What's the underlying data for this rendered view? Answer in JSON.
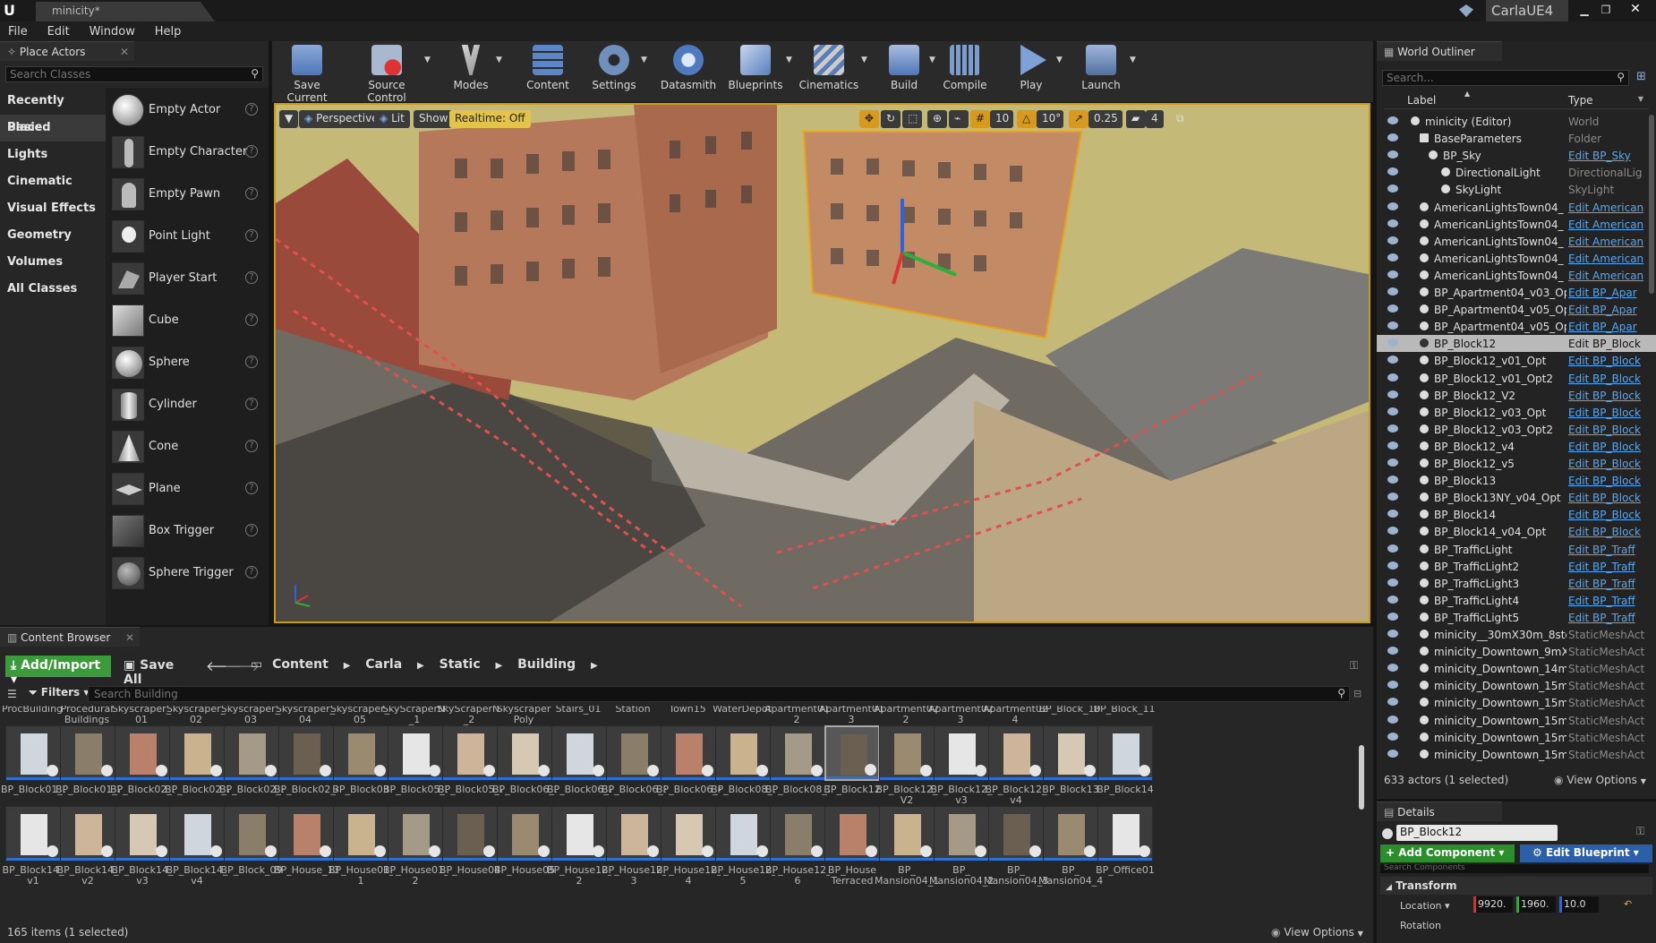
{
  "titlebar": {
    "tab_title": "minicity*",
    "project_name": "CarlaUE4"
  },
  "menu": [
    "File",
    "Edit",
    "Window",
    "Help"
  ],
  "place_actors": {
    "tab_label": "Place Actors",
    "search_placeholder": "Search Classes",
    "categories": [
      "Recently Placed",
      "Basic",
      "Lights",
      "Cinematic",
      "Visual Effects",
      "Geometry",
      "Volumes",
      "All Classes"
    ],
    "selected_category": "Basic",
    "items": [
      "Empty Actor",
      "Empty Character",
      "Empty Pawn",
      "Point Light",
      "Player Start",
      "Cube",
      "Sphere",
      "Cylinder",
      "Cone",
      "Plane",
      "Box Trigger",
      "Sphere Trigger"
    ]
  },
  "toolbar": {
    "buttons": [
      "Save Current",
      "Source Control",
      "Modes",
      "Content",
      "Settings",
      "Datasmith",
      "Blueprints",
      "Cinematics",
      "Build",
      "Compile",
      "Play",
      "Launch"
    ]
  },
  "viewport": {
    "perspective": "Perspective",
    "lit": "Lit",
    "show": "Show",
    "realtime": "Realtime: Off",
    "grid_snap": "10",
    "rotation_snap": "10°",
    "scale_snap": "0.25",
    "camera_speed": "4"
  },
  "outliner": {
    "tab_label": "World Outliner",
    "search_placeholder": "Search...",
    "col_label": "Label",
    "col_type": "Type",
    "rows": [
      {
        "label": "minicity (Editor)",
        "type": "World",
        "indent": 1,
        "link": false
      },
      {
        "label": "BaseParameters",
        "type": "Folder",
        "indent": 2,
        "link": false
      },
      {
        "label": "BP_Sky",
        "type": "Edit BP_Sky",
        "indent": 3,
        "link": true
      },
      {
        "label": "DirectionalLight",
        "type": "DirectionalLig",
        "indent": 4,
        "link": false
      },
      {
        "label": "SkyLight",
        "type": "SkyLight",
        "indent": 4,
        "link": false
      },
      {
        "label": "AmericanLightsTown04_",
        "type": "Edit American",
        "indent": 2,
        "link": true
      },
      {
        "label": "AmericanLightsTown04_",
        "type": "Edit American",
        "indent": 2,
        "link": true
      },
      {
        "label": "AmericanLightsTown04_",
        "type": "Edit American",
        "indent": 2,
        "link": true
      },
      {
        "label": "AmericanLightsTown04_",
        "type": "Edit American",
        "indent": 2,
        "link": true
      },
      {
        "label": "AmericanLightsTown04_",
        "type": "Edit American",
        "indent": 2,
        "link": true
      },
      {
        "label": "BP_Apartment04_v03_Op",
        "type": "Edit BP_Apar",
        "indent": 2,
        "link": true
      },
      {
        "label": "BP_Apartment04_v05_Op",
        "type": "Edit BP_Apar",
        "indent": 2,
        "link": true
      },
      {
        "label": "BP_Apartment04_v05_Op",
        "type": "Edit BP_Apar",
        "indent": 2,
        "link": true
      },
      {
        "label": "BP_Block12",
        "type": "Edit BP_Block",
        "indent": 2,
        "link": false,
        "selected": true
      },
      {
        "label": "BP_Block12_v01_Opt",
        "type": "Edit BP_Block",
        "indent": 2,
        "link": true
      },
      {
        "label": "BP_Block12_v01_Opt2",
        "type": "Edit BP_Block",
        "indent": 2,
        "link": true
      },
      {
        "label": "BP_Block12_V2",
        "type": "Edit BP_Block",
        "indent": 2,
        "link": true
      },
      {
        "label": "BP_Block12_v03_Opt",
        "type": "Edit BP_Block",
        "indent": 2,
        "link": true
      },
      {
        "label": "BP_Block12_v03_Opt2",
        "type": "Edit BP_Block",
        "indent": 2,
        "link": true
      },
      {
        "label": "BP_Block12_v4",
        "type": "Edit BP_Block",
        "indent": 2,
        "link": true
      },
      {
        "label": "BP_Block12_v5",
        "type": "Edit BP_Block",
        "indent": 2,
        "link": true
      },
      {
        "label": "BP_Block13",
        "type": "Edit BP_Block",
        "indent": 2,
        "link": true
      },
      {
        "label": "BP_Block13NY_v04_Opt",
        "type": "Edit BP_Block",
        "indent": 2,
        "link": true
      },
      {
        "label": "BP_Block14",
        "type": "Edit BP_Block",
        "indent": 2,
        "link": true
      },
      {
        "label": "BP_Block14_v04_Opt",
        "type": "Edit BP_Block",
        "indent": 2,
        "link": true
      },
      {
        "label": "BP_TrafficLight",
        "type": "Edit BP_Traff",
        "indent": 2,
        "link": true
      },
      {
        "label": "BP_TrafficLight2",
        "type": "Edit BP_Traff",
        "indent": 2,
        "link": true
      },
      {
        "label": "BP_TrafficLight3",
        "type": "Edit BP_Traff",
        "indent": 2,
        "link": true
      },
      {
        "label": "BP_TrafficLight4",
        "type": "Edit BP_Traff",
        "indent": 2,
        "link": true
      },
      {
        "label": "BP_TrafficLight5",
        "type": "Edit BP_Traff",
        "indent": 2,
        "link": true
      },
      {
        "label": "minicity__30mX30m_8sto",
        "type": "StaticMeshAct",
        "indent": 2,
        "link": false
      },
      {
        "label": "minicity_Downtown_9mX",
        "type": "StaticMeshAct",
        "indent": 2,
        "link": false
      },
      {
        "label": "minicity_Downtown_14m",
        "type": "StaticMeshAct",
        "indent": 2,
        "link": false
      },
      {
        "label": "minicity_Downtown_15m",
        "type": "StaticMeshAct",
        "indent": 2,
        "link": false
      },
      {
        "label": "minicity_Downtown_15m",
        "type": "StaticMeshAct",
        "indent": 2,
        "link": false
      },
      {
        "label": "minicity_Downtown_15m",
        "type": "StaticMeshAct",
        "indent": 2,
        "link": false
      },
      {
        "label": "minicity_Downtown_15m",
        "type": "StaticMeshAct",
        "indent": 2,
        "link": false
      },
      {
        "label": "minicity_Downtown_15m",
        "type": "StaticMeshAct",
        "indent": 2,
        "link": false
      }
    ],
    "actor_count": "633 actors (1 selected)",
    "view_options": "View Options"
  },
  "details": {
    "tab_label": "Details",
    "name_value": "BP_Block12",
    "add_component": "+ Add Component",
    "edit_blueprint": "Edit Blueprint",
    "search_placeholder": "Search Components",
    "transform": "Transform",
    "location_label": "Location",
    "loc_x": "9920.",
    "loc_y": "1960.",
    "loc_z": "10.0",
    "rotation_label": "Rotation"
  },
  "content_browser": {
    "tab_label": "Content Browser",
    "add_import": "Add/Import",
    "save_all": "Save All",
    "path": [
      "Content",
      "Carla",
      "Static",
      "Building"
    ],
    "filters": "Filters",
    "search_placeholder": "Search Building",
    "header_labels": [
      "ProcBuilding",
      "Procedural Buildings",
      "Skyscraper_ 01",
      "Skyscraper_ 02",
      "Skyscraper_ 03",
      "Skyscraper_ 04",
      "Skyscraper_ 05",
      "SkyScraperNY _1",
      "SkyScraperNY _2",
      "Skyscraper Poly",
      "Stairs_01",
      "Station",
      "Town15",
      "WaterDepot",
      "Apartment01 2",
      "Apartment01 3",
      "Apartment02 2",
      "Apartment02 3",
      "Apartment02 4",
      "BP_Block_10",
      "BP_Block_11"
    ],
    "row1": [
      "BP_Block01_1",
      "BP_Block01_2",
      "BP_Block02_1",
      "BP_Block02_2",
      "BP_Block02_3",
      "BP_Block02_4",
      "BP_Block03",
      "BP_Block05_1",
      "BP_Block05_2",
      "BP_Block06_1",
      "BP_Block06_2",
      "BP_Block06_3",
      "BP_Block06_4",
      "BP_Block08_1",
      "BP_Block08_2",
      "BP_Block12",
      "BP_Block12_ V2",
      "BP_Block12_ v3",
      "BP_Block12_ v4",
      "BP_Block13",
      "BP_Block14"
    ],
    "row2": [
      "BP_Block14_ v1",
      "BP_Block14_ v2",
      "BP_Block14_ v3",
      "BP_Block14_ v4",
      "BP_Block_09",
      "BP_House_13",
      "BP_House01_ 1",
      "BP_House01_ 2",
      "BP_House04",
      "BP_House05",
      "BP_House12_ 2",
      "BP_House12_ 3",
      "BP_House12_ 4",
      "BP_House12_ 5",
      "BP_House12_ 6",
      "BP_House Terraced",
      "BP_ Mansion04_1",
      "BP_ Mansion04_2",
      "BP_ Mansion04_3",
      "BP_ Mansion04_4",
      "BP_Office01"
    ],
    "item_count": "165 items (1 selected)",
    "view_options": "View Options"
  }
}
